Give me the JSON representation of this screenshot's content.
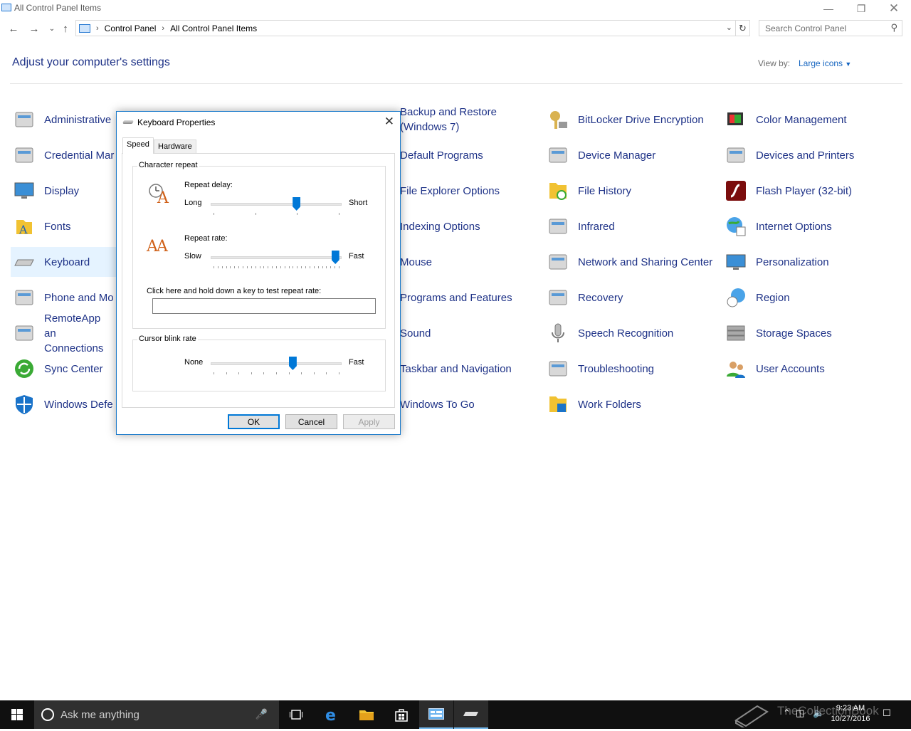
{
  "window": {
    "title": "All Control Panel Items"
  },
  "address": {
    "crumbs": [
      "Control Panel",
      "All Control Panel Items"
    ]
  },
  "search": {
    "placeholder": "Search Control Panel"
  },
  "heading": "Adjust your computer's settings",
  "view_by": {
    "label": "View by:",
    "value": "Large icons"
  },
  "items": [
    {
      "label": "Administrative",
      "icon": "admin-tools-icon"
    },
    {
      "label": "Credential Mar",
      "icon": "credential-manager-icon"
    },
    {
      "label": "Display",
      "icon": "display-icon"
    },
    {
      "label": "Fonts",
      "icon": "fonts-icon"
    },
    {
      "label": "Keyboard",
      "icon": "keyboard-icon"
    },
    {
      "label": "Phone and Mo",
      "icon": "phone-modem-icon"
    },
    {
      "label": "RemoteApp an Connections",
      "icon": "remoteapp-icon"
    },
    {
      "label": "Sync Center",
      "icon": "sync-center-icon"
    },
    {
      "label": "Windows Defe",
      "icon": "windows-defender-icon"
    },
    {
      "label": "Backup and Restore (Windows 7)",
      "icon": "backup-restore-icon"
    },
    {
      "label": "Default Programs",
      "icon": "default-programs-icon"
    },
    {
      "label": "File Explorer Options",
      "icon": "file-explorer-options-icon"
    },
    {
      "label": "Indexing Options",
      "icon": "indexing-options-icon"
    },
    {
      "label": "Mouse",
      "icon": "mouse-icon"
    },
    {
      "label": "Programs and Features",
      "icon": "programs-features-icon"
    },
    {
      "label": "Sound",
      "icon": "sound-icon"
    },
    {
      "label": "Taskbar and Navigation",
      "icon": "taskbar-icon"
    },
    {
      "label": "Windows To Go",
      "icon": "windows-to-go-icon"
    },
    {
      "label": "BitLocker Drive Encryption",
      "icon": "bitlocker-icon"
    },
    {
      "label": "Device Manager",
      "icon": "device-manager-icon"
    },
    {
      "label": "File History",
      "icon": "file-history-icon"
    },
    {
      "label": "Infrared",
      "icon": "infrared-icon"
    },
    {
      "label": "Network and Sharing Center",
      "icon": "network-sharing-icon"
    },
    {
      "label": "Recovery",
      "icon": "recovery-icon"
    },
    {
      "label": "Speech Recognition",
      "icon": "speech-recognition-icon"
    },
    {
      "label": "Troubleshooting",
      "icon": "troubleshooting-icon"
    },
    {
      "label": "Work Folders",
      "icon": "work-folders-icon"
    },
    {
      "label": "Color Management",
      "icon": "color-management-icon"
    },
    {
      "label": "Devices and Printers",
      "icon": "devices-printers-icon"
    },
    {
      "label": "Flash Player (32-bit)",
      "icon": "flash-player-icon"
    },
    {
      "label": "Internet Options",
      "icon": "internet-options-icon"
    },
    {
      "label": "Personalization",
      "icon": "personalization-icon"
    },
    {
      "label": "Region",
      "icon": "region-icon"
    },
    {
      "label": "Storage Spaces",
      "icon": "storage-spaces-icon"
    },
    {
      "label": "User Accounts",
      "icon": "user-accounts-icon"
    }
  ],
  "dialog": {
    "title": "Keyboard Properties",
    "tabs": [
      "Speed",
      "Hardware"
    ],
    "character_repeat": {
      "group_label": "Character repeat",
      "repeat_delay": {
        "label": "Repeat delay:",
        "min_label": "Long",
        "max_label": "Short",
        "value_fraction": 0.66
      },
      "repeat_rate": {
        "label": "Repeat rate:",
        "min_label": "Slow",
        "max_label": "Fast",
        "value_fraction": 0.97
      },
      "test_label": "Click here and hold down a key to test repeat rate:",
      "test_value": ""
    },
    "cursor_blink": {
      "group_label": "Cursor blink rate",
      "min_label": "None",
      "max_label": "Fast",
      "value_fraction": 0.63
    },
    "buttons": {
      "ok": "OK",
      "cancel": "Cancel",
      "apply": "Apply"
    }
  },
  "taskbar": {
    "search_placeholder": "Ask me anything",
    "time": "9:23 AM",
    "date": "10/27/2016",
    "watermark": "TheCollectionBook"
  },
  "colors": {
    "link": "#1e3287",
    "accent": "#0078d7",
    "taskbar": "#101010"
  }
}
